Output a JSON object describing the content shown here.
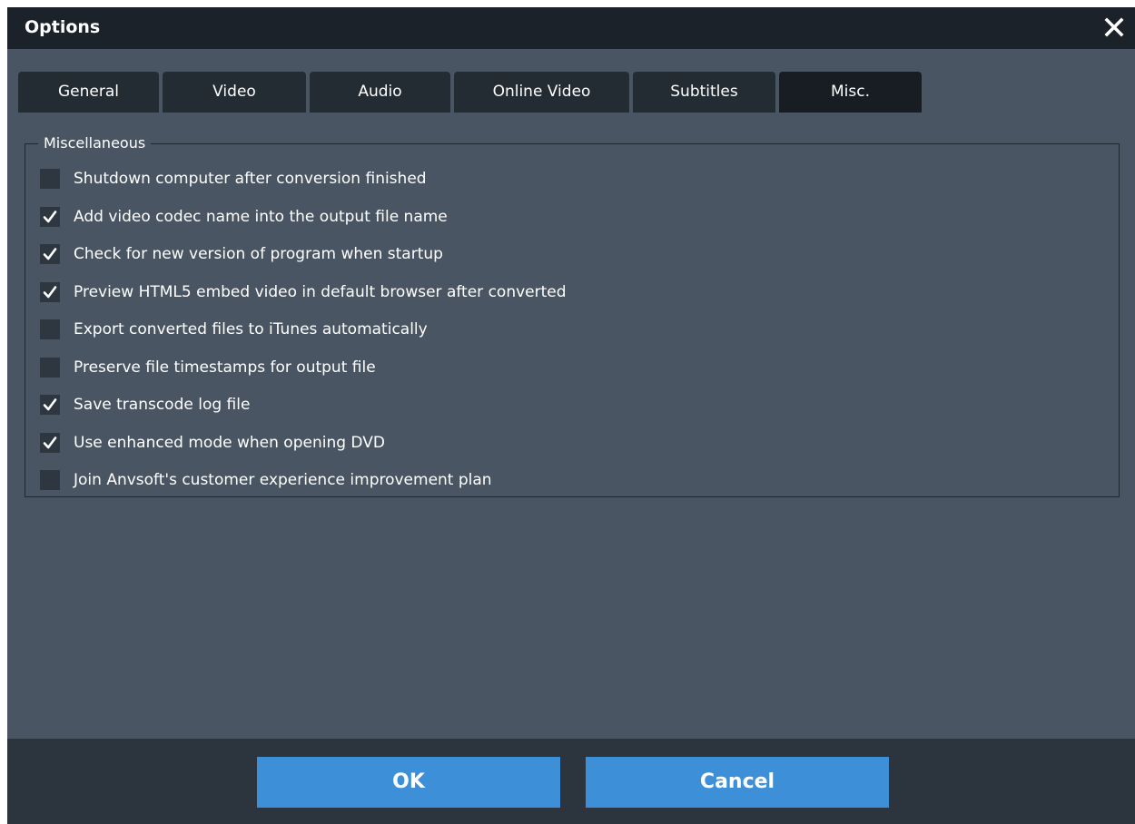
{
  "window": {
    "title": "Options"
  },
  "tabs": [
    {
      "label": "General"
    },
    {
      "label": "Video"
    },
    {
      "label": "Audio"
    },
    {
      "label": "Online Video"
    },
    {
      "label": "Subtitles"
    },
    {
      "label": "Misc."
    }
  ],
  "active_tab": "Misc.",
  "group": {
    "legend": "Miscellaneous"
  },
  "options": [
    {
      "label": "Shutdown computer after conversion finished",
      "checked": false
    },
    {
      "label": "Add video codec name into the output file name",
      "checked": true
    },
    {
      "label": "Check for new version of program when startup",
      "checked": true
    },
    {
      "label": "Preview HTML5 embed video in default browser after converted",
      "checked": true
    },
    {
      "label": "Export converted files to iTunes automatically",
      "checked": false
    },
    {
      "label": "Preserve file timestamps for output file",
      "checked": false
    },
    {
      "label": "Save transcode log file",
      "checked": true
    },
    {
      "label": "Use enhanced mode when opening DVD",
      "checked": true
    },
    {
      "label": "Join Anvsoft's customer experience improvement plan",
      "checked": false
    }
  ],
  "buttons": {
    "ok": "OK",
    "cancel": "Cancel"
  },
  "colors": {
    "titlebar_bg": "#1b2229",
    "body_bg": "#495562",
    "tab_bg": "#232b33",
    "tab_active_bg": "#171d23",
    "footer_bg": "#2c353e",
    "button_bg": "#3d8fd7",
    "checkbox_bg": "#2e3640"
  }
}
